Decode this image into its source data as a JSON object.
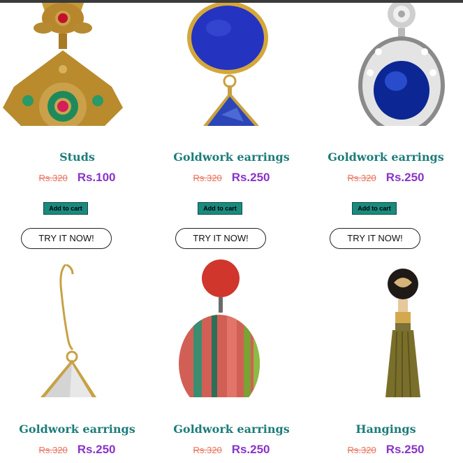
{
  "products": [
    {
      "title": "Studs",
      "old_price": "Rs.320",
      "new_price": "Rs.100",
      "cart_label": "Add to cart",
      "try_label": "TRY IT NOW!",
      "image_icon": "gold-stud-earring-icon"
    },
    {
      "title": "Goldwork earrings",
      "old_price": "Rs.320",
      "new_price": "Rs.250",
      "cart_label": "Add to cart",
      "try_label": "TRY IT NOW!",
      "image_icon": "lapis-earring-icon"
    },
    {
      "title": "Goldwork earrings",
      "old_price": "Rs.320",
      "new_price": "Rs.250",
      "cart_label": "Add to cart",
      "try_label": "TRY IT NOW!",
      "image_icon": "sapphire-pendant-earring-icon"
    },
    {
      "title": "Goldwork earrings",
      "old_price": "Rs.320",
      "new_price": "Rs.250",
      "image_icon": "crystal-hook-earring-icon"
    },
    {
      "title": "Goldwork earrings",
      "old_price": "Rs.320",
      "new_price": "Rs.250",
      "image_icon": "striped-disc-earring-icon"
    },
    {
      "title": "Hangings",
      "old_price": "Rs.320",
      "new_price": "Rs.250",
      "image_icon": "tassel-earring-icon"
    }
  ],
  "colors": {
    "title": "#1d7d7a",
    "old_price": "#e8735e",
    "new_price": "#8a33c8",
    "cart_button": "#1a8a7f"
  }
}
